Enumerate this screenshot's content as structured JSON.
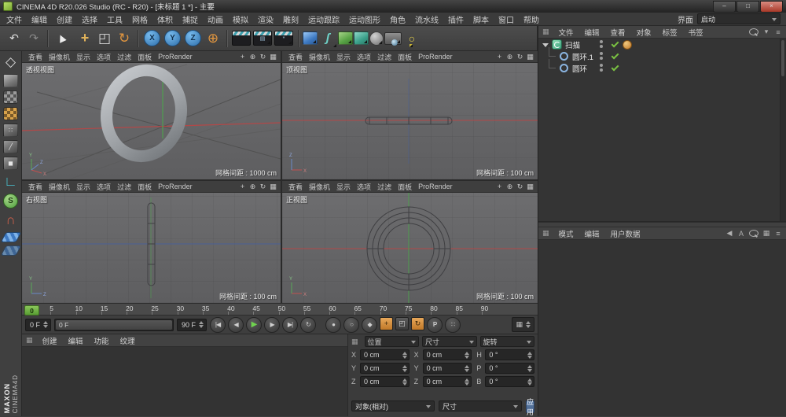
{
  "title_bar": {
    "title": "CINEMA 4D R20.026 Studio (RC - R20) - [未标题 1 *] - 主要",
    "minimize_glyph": "–",
    "maximize_glyph": "□",
    "close_glyph": "×"
  },
  "menu_bar": {
    "items": [
      "文件",
      "编辑",
      "创建",
      "选择",
      "工具",
      "网格",
      "体积",
      "捕捉",
      "动画",
      "模拟",
      "渲染",
      "雕刻",
      "运动跟踪",
      "运动图形",
      "角色",
      "流水线",
      "插件",
      "脚本",
      "窗口",
      "帮助"
    ],
    "interface_label": "界面",
    "layout_value": "启动"
  },
  "icons": {
    "panel_menu": "▦"
  },
  "toolbar": {
    "history": [
      {
        "name": "undo-icon",
        "glyph": "↶",
        "cls": "fg-light"
      },
      {
        "name": "redo-icon",
        "glyph": "↷",
        "cls": "fg-dim"
      }
    ],
    "selection": [
      {
        "name": "live-selection-icon",
        "glyph": "▶",
        "cls": "cursor"
      }
    ],
    "transform": [
      {
        "name": "move-icon",
        "glyph": "+",
        "cls": "move"
      },
      {
        "name": "scale-icon",
        "glyph": "◰",
        "cls": "fg-light big"
      },
      {
        "name": "rotate-icon",
        "glyph": "↻",
        "cls": "fg-orange big"
      }
    ],
    "axis_locks": [
      {
        "name": "lock-x-axis-button",
        "glyph": "X",
        "cls": "axis"
      },
      {
        "name": "lock-y-axis-button",
        "glyph": "Y",
        "cls": "axis"
      },
      {
        "name": "lock-z-axis-button",
        "glyph": "Z",
        "cls": "axis"
      },
      {
        "name": "coordinate-system-button",
        "glyph": "⊕",
        "cls": "fg-orange big"
      }
    ],
    "render": [
      {
        "name": "render-view-button",
        "glyph": "",
        "cls": "clap"
      },
      {
        "name": "render-picture-viewer-button",
        "glyph": "▤",
        "cls": "clap tri"
      },
      {
        "name": "render-settings-button",
        "glyph": "*",
        "cls": "clap tri"
      }
    ],
    "create": [
      {
        "name": "add-cube-button",
        "glyph": "",
        "cls": "cube c-blue tri"
      },
      {
        "name": "draw-spline-button",
        "glyph": "ʃ",
        "cls": "pen tri"
      },
      {
        "name": "subdivision-surface-button",
        "glyph": "",
        "cls": "cube c-green tri"
      },
      {
        "name": "generator-button",
        "glyph": "",
        "cls": "cube c-teal tri"
      },
      {
        "name": "environment-button",
        "glyph": "",
        "cls": "sphere tri"
      },
      {
        "name": "camera-button",
        "glyph": "",
        "cls": "cam tri"
      },
      {
        "name": "light-button",
        "glyph": "○",
        "cls": "bulb tri"
      }
    ]
  },
  "left_toolbar": {
    "icons": [
      {
        "name": "make-editable-icon",
        "glyph": "◇",
        "cls": "fg-light big"
      },
      {
        "name": "model-mode-icon",
        "glyph": "",
        "cls": "cube c-gray"
      },
      {
        "name": "texture-mode-icon",
        "glyph": "",
        "cls": "checker"
      },
      {
        "name": "texture-axis-mode-icon",
        "glyph": "",
        "cls": "checker warm"
      },
      {
        "name": "points-mode-icon",
        "glyph": "∷",
        "cls": "cube c-dark"
      },
      {
        "name": "edges-mode-icon",
        "glyph": "╱",
        "cls": "cube c-dark"
      },
      {
        "name": "polygons-mode-icon",
        "glyph": "◼",
        "cls": "cube c-dark"
      },
      {
        "name": "enable-axis-icon",
        "glyph": "∟",
        "cls": "fg-cyan big"
      },
      {
        "name": "viewport-solo-icon",
        "glyph": "S",
        "cls": "circ-green"
      },
      {
        "name": "enable-snap-icon",
        "glyph": "∩",
        "cls": "snapg big"
      },
      {
        "name": "workplane-icon",
        "glyph": "",
        "cls": "plane"
      },
      {
        "name": "lock-workplane-icon",
        "glyph": "",
        "cls": "plane locked"
      }
    ]
  },
  "viewports": {
    "menu_items": [
      "查看",
      "摄像机",
      "显示",
      "选项",
      "过滤",
      "面板"
    ],
    "prorender_label": "ProRender",
    "header_icons": [
      {
        "name": "pan-view-icon",
        "glyph": "+"
      },
      {
        "name": "zoom-view-icon",
        "glyph": "⊕"
      },
      {
        "name": "rotate-view-icon",
        "glyph": "↻"
      },
      {
        "name": "toggle-view-icon",
        "glyph": "▦"
      }
    ],
    "panels": [
      {
        "label": "透视视图",
        "grid_label": "网格间距 : 1000 cm"
      },
      {
        "label": "顶视图",
        "grid_label": "网格间距 : 100 cm"
      },
      {
        "label": "右视图",
        "grid_label": "网格间距 : 100 cm"
      },
      {
        "label": "正视图",
        "grid_label": "网格间距 : 100 cm"
      }
    ]
  },
  "timeline": {
    "ticks": [
      "0",
      "5",
      "10",
      "15",
      "20",
      "25",
      "30",
      "35",
      "40",
      "45",
      "50",
      "55",
      "60",
      "65",
      "70",
      "75",
      "80",
      "85",
      "90"
    ],
    "playhead": "0",
    "current_frame": "0 F",
    "range_start_label": "0 F",
    "end_frame": "90 F",
    "transport": [
      {
        "name": "goto-start-button",
        "glyph": "|◀",
        "cls": ""
      },
      {
        "name": "previous-frame-button",
        "glyph": "◀",
        "cls": ""
      },
      {
        "name": "play-button",
        "glyph": "▶",
        "cls": "play"
      },
      {
        "name": "next-frame-button",
        "glyph": "▶",
        "cls": ""
      },
      {
        "name": "goto-end-button",
        "glyph": "▶|",
        "cls": ""
      },
      {
        "name": "loop-button",
        "glyph": "↻",
        "cls": ""
      }
    ],
    "record": [
      {
        "name": "record-keyframe-button",
        "glyph": "●",
        "cls": "fg-red"
      },
      {
        "name": "autokeying-button",
        "glyph": "○",
        "cls": "fg-red"
      },
      {
        "name": "keyframe-selection-button",
        "glyph": "◆",
        "cls": "fg-purple"
      },
      {
        "name": "record-position-toggle",
        "glyph": "+",
        "cls": "sq warm-sq"
      },
      {
        "name": "record-scale-toggle",
        "glyph": "◰",
        "cls": "sq"
      },
      {
        "name": "record-rotation-toggle",
        "glyph": "↻",
        "cls": "sq warm-sq"
      },
      {
        "name": "record-parameter-toggle",
        "glyph": "P",
        "cls": "circ-green"
      },
      {
        "name": "record-pla-toggle",
        "glyph": "∷",
        "cls": "circ-gray"
      }
    ]
  },
  "material_manager": {
    "tabs": [
      "创建",
      "编辑",
      "功能",
      "纹理"
    ]
  },
  "coordinates": {
    "columns": [
      {
        "header": "位置",
        "rows": [
          {
            "label": "X",
            "value": "0 cm"
          },
          {
            "label": "Y",
            "value": "0 cm"
          },
          {
            "label": "Z",
            "value": "0 cm"
          }
        ]
      },
      {
        "header": "尺寸",
        "rows": [
          {
            "label": "X",
            "value": "0 cm"
          },
          {
            "label": "Y",
            "value": "0 cm"
          },
          {
            "label": "Z",
            "value": "0 cm"
          }
        ]
      },
      {
        "header": "旋转",
        "rows": [
          {
            "label": "H",
            "value": "0 °"
          },
          {
            "label": "P",
            "value": "0 °"
          },
          {
            "label": "B",
            "value": "0 °"
          }
        ]
      }
    ],
    "mode_value": "对象(相对)",
    "size_mode_value": "尺寸",
    "apply_label": "应用"
  },
  "object_manager": {
    "menus": [
      "文件",
      "编辑",
      "查看",
      "对象",
      "标签",
      "书签"
    ],
    "header_icons": [
      {
        "name": "search-icon",
        "glyph": "",
        "cls": "mag"
      },
      {
        "name": "filter-icon",
        "glyph": "▾",
        "cls": ""
      },
      {
        "name": "panel-menu-icon",
        "glyph": "≡",
        "cls": ""
      }
    ],
    "objects": [
      {
        "name": "扫描"
      },
      {
        "name": "圆环.1"
      },
      {
        "name": "圆环"
      }
    ]
  },
  "attribute_manager": {
    "tabs": [
      "模式",
      "编辑",
      "用户数据"
    ],
    "header_icons": [
      {
        "name": "history-back-icon",
        "glyph": "◀",
        "cls": ""
      },
      {
        "name": "text-icon",
        "glyph": "A",
        "cls": ""
      },
      {
        "name": "search-icon",
        "glyph": "",
        "cls": "mag"
      },
      {
        "name": "layout-icon",
        "glyph": "▦",
        "cls": ""
      },
      {
        "name": "panel-menu-icon",
        "glyph": "≡",
        "cls": ""
      }
    ]
  },
  "branding": {
    "maxon": "MAXON",
    "cinema": "CINEMA4D"
  },
  "colors": {
    "axis_x": "#b24848",
    "axis_y": "#4f9e4f",
    "axis_z": "#4a6096",
    "accent_green": "#8dc63f",
    "check_green": "#7ac142",
    "apply_blue": "#46628c"
  }
}
